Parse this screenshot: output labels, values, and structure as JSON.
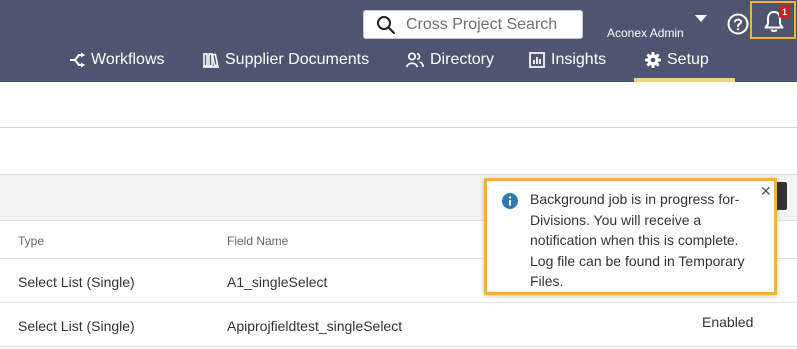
{
  "header": {
    "search": {
      "placeholder": "Cross Project Search",
      "value": ""
    },
    "user_name": "Aconex Admin",
    "notification_count": "1",
    "nav": [
      {
        "label": "Workflows",
        "icon": "workflows-icon"
      },
      {
        "label": "Supplier Documents",
        "icon": "supplier-documents-icon"
      },
      {
        "label": "Directory",
        "icon": "directory-icon"
      },
      {
        "label": "Insights",
        "icon": "insights-icon"
      },
      {
        "label": "Setup",
        "icon": "gear-icon",
        "active": true
      }
    ]
  },
  "table": {
    "columns": [
      "Type",
      "Field Name"
    ],
    "rows": [
      {
        "type": "Select List (Single)",
        "field_name": "A1_singleSelect",
        "status": ""
      },
      {
        "type": "Select List (Single)",
        "field_name": "Apiprojfieldtest_singleSelect",
        "status": "Enabled"
      }
    ]
  },
  "notification": {
    "message": "Background job is in progress for-Divisions. You will receive a notification when this is complete. Log file can be found in Temporary Files.",
    "close_label": "✕"
  },
  "colors": {
    "header_bg": "#4f5571",
    "active_tab_underline": "#f3d285",
    "highlight_border": "#f0b23b",
    "info_icon": "#2e7bb4",
    "badge": "#d51d1d"
  }
}
